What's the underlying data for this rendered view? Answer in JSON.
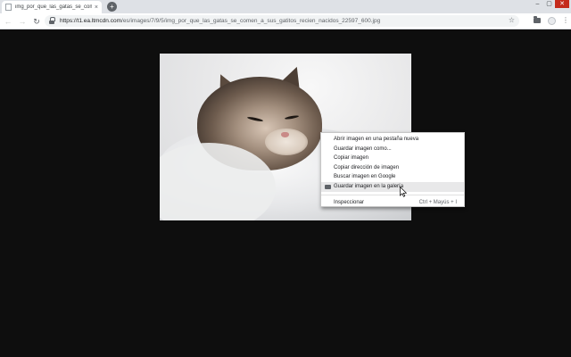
{
  "tab": {
    "title": "img_por_que_las_gatas_se_come",
    "close_glyph": "×"
  },
  "window_controls": {
    "minimize": "–",
    "maximize": "▢",
    "close": "✕"
  },
  "toolbar": {
    "back_glyph": "←",
    "forward_glyph": "→",
    "reload_glyph": "↻",
    "url_host": "https://t1.ea.ltmcdn.com",
    "url_path": "/es/images/7/9/5/img_por_que_las_gatas_se_comen_a_sus_gatitos_recien_nacidos_22597_600.jpg",
    "star_glyph": "☆",
    "menu_glyph": "⋮"
  },
  "context_menu": {
    "items": [
      "Abrir imagen en una pestaña nueva",
      "Guardar imagen como...",
      "Copiar imagen",
      "Copiar dirección de imagen",
      "Buscar imagen en Google",
      "Guardar imagen en la galería"
    ],
    "inspect_label": "Inspeccionar",
    "inspect_shortcut": "Ctrl + Mayús + I"
  },
  "icons": {
    "tab_favicon": "page-icon",
    "lock": "lock-icon",
    "bookmark": "star-icon",
    "extension": "folder-icon",
    "profile": "avatar-icon",
    "menu": "kebab-menu-icon",
    "gallery_item": "gallery-icon",
    "pointer": "mouse-cursor-icon"
  }
}
